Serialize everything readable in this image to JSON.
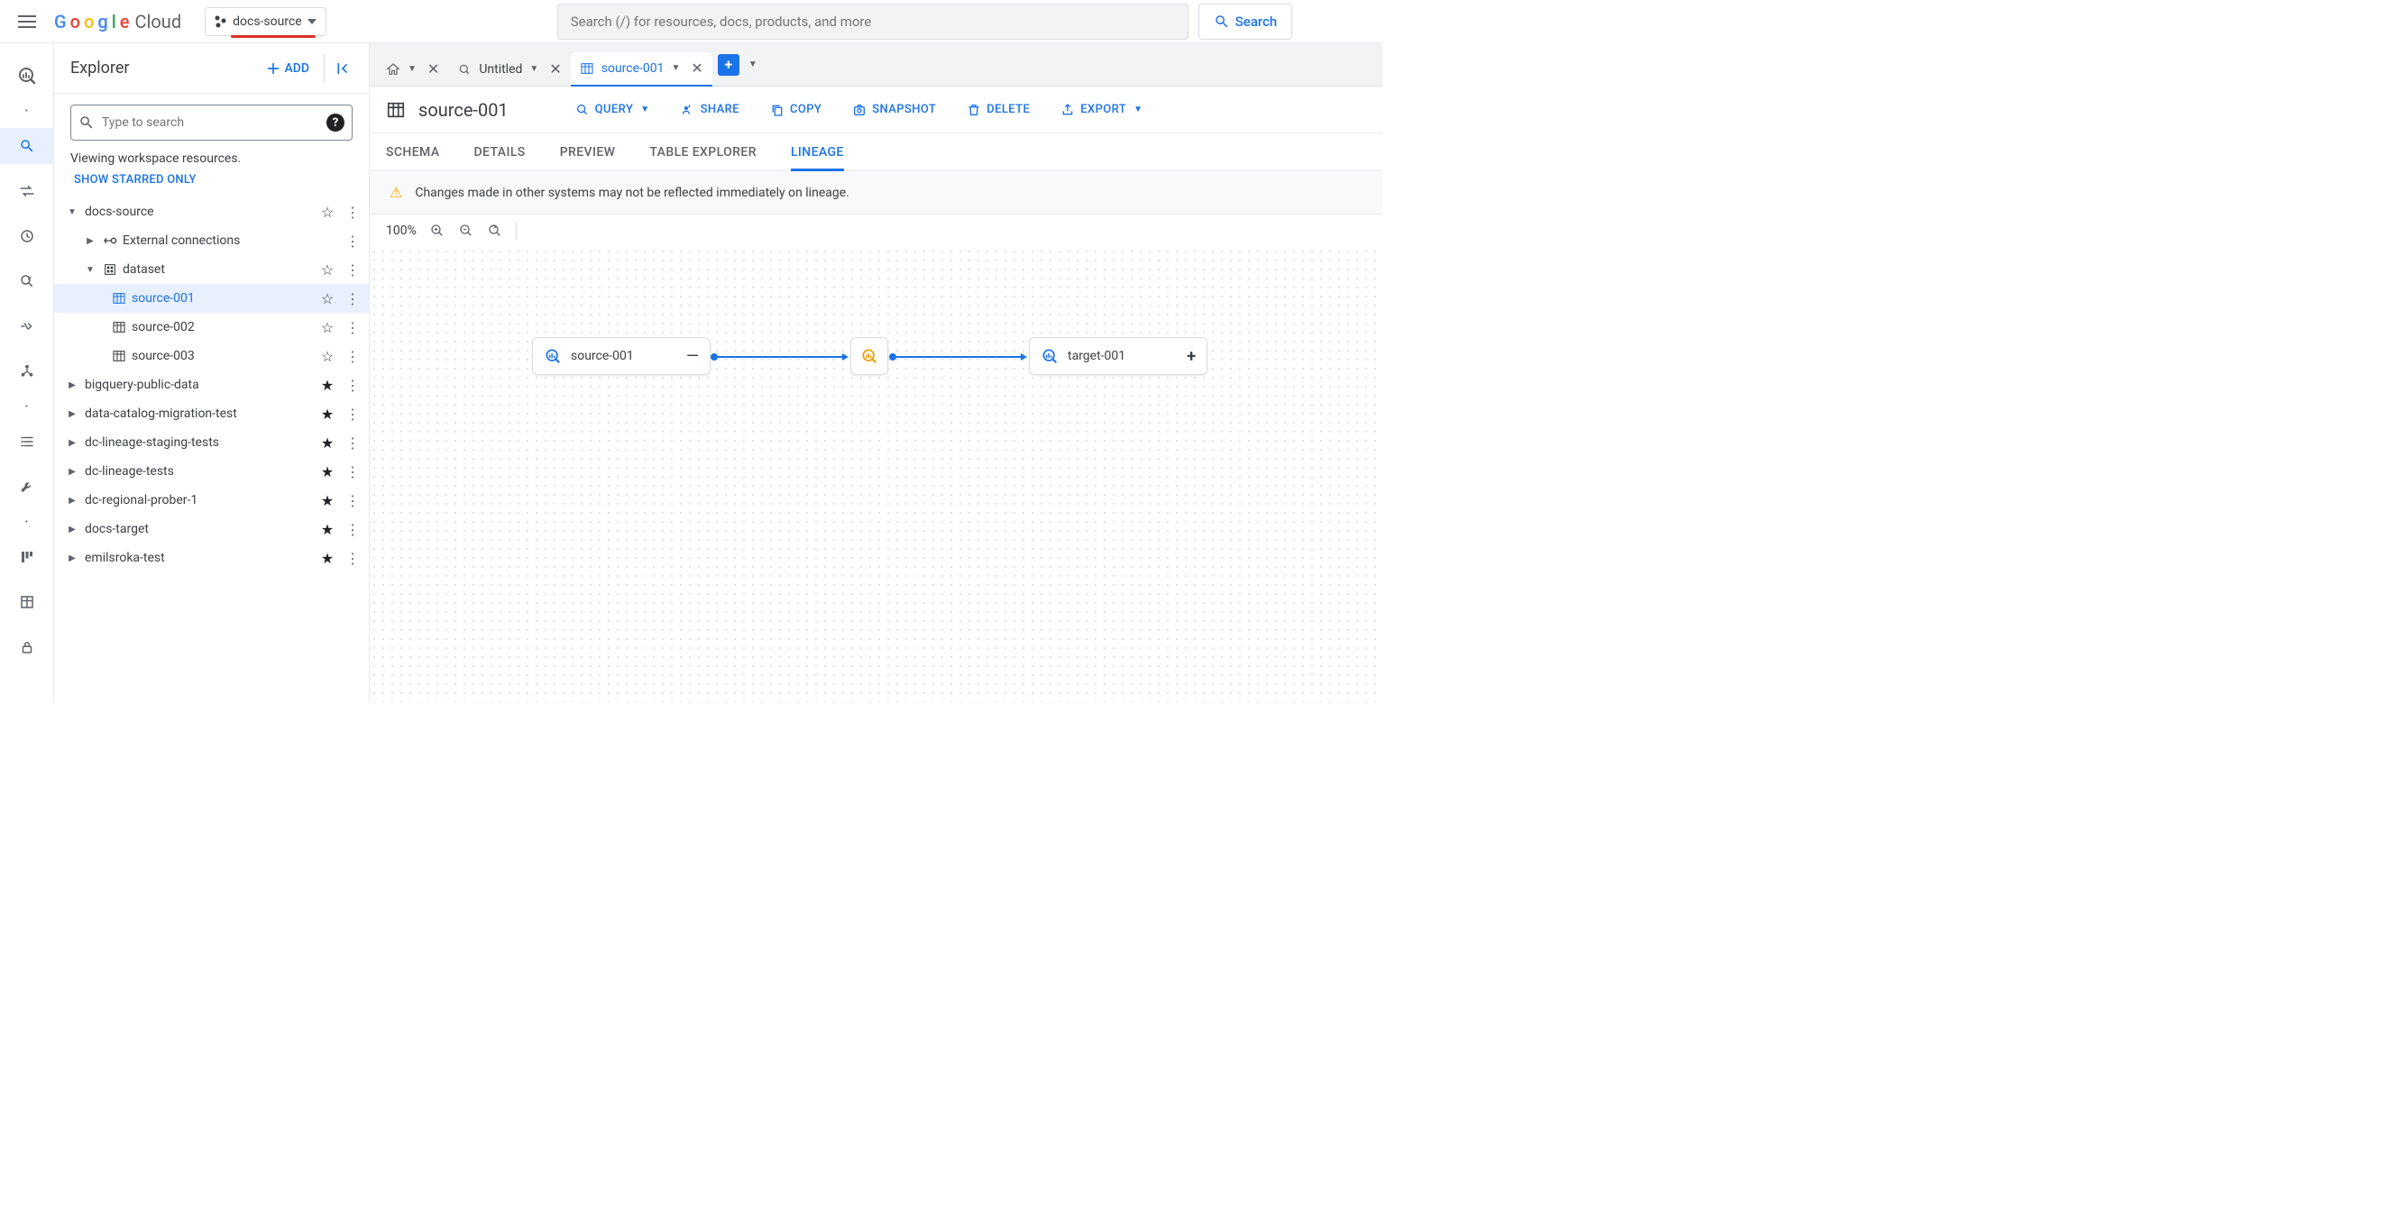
{
  "header": {
    "logo_cloud": "Cloud",
    "project": "docs-source",
    "search_placeholder": "Search (/) for resources, docs, products, and more",
    "search_button": "Search"
  },
  "explorer": {
    "title": "Explorer",
    "add": "ADD",
    "search_placeholder": "Type to search",
    "viewing": "Viewing workspace resources.",
    "show_starred": "SHOW STARRED ONLY",
    "tree": {
      "root": "docs-source",
      "ext_conn": "External connections",
      "dataset": "dataset",
      "src1": "source-001",
      "src2": "source-002",
      "src3": "source-003",
      "p_bq": "bigquery-public-data",
      "p_dcm": "data-catalog-migration-test",
      "p_stage": "dc-lineage-staging-tests",
      "p_lin": "dc-lineage-tests",
      "p_reg": "dc-regional-prober-1",
      "p_tgt": "docs-target",
      "p_emil": "emilsroka-test"
    }
  },
  "tabs": {
    "untitled": "Untitled",
    "src001": "source-001"
  },
  "page": {
    "title": "source-001",
    "actions": {
      "query": "QUERY",
      "share": "SHARE",
      "copy": "COPY",
      "snapshot": "SNAPSHOT",
      "delete": "DELETE",
      "export": "EXPORT"
    },
    "subtabs": {
      "schema": "SCHEMA",
      "details": "DETAILS",
      "preview": "PREVIEW",
      "explorer": "TABLE EXPLORER",
      "lineage": "LINEAGE"
    },
    "warning": "Changes made in other systems may not be reflected immediately on lineage.",
    "zoom": "100%"
  },
  "lineage": {
    "source": "source-001",
    "target": "target-001"
  }
}
